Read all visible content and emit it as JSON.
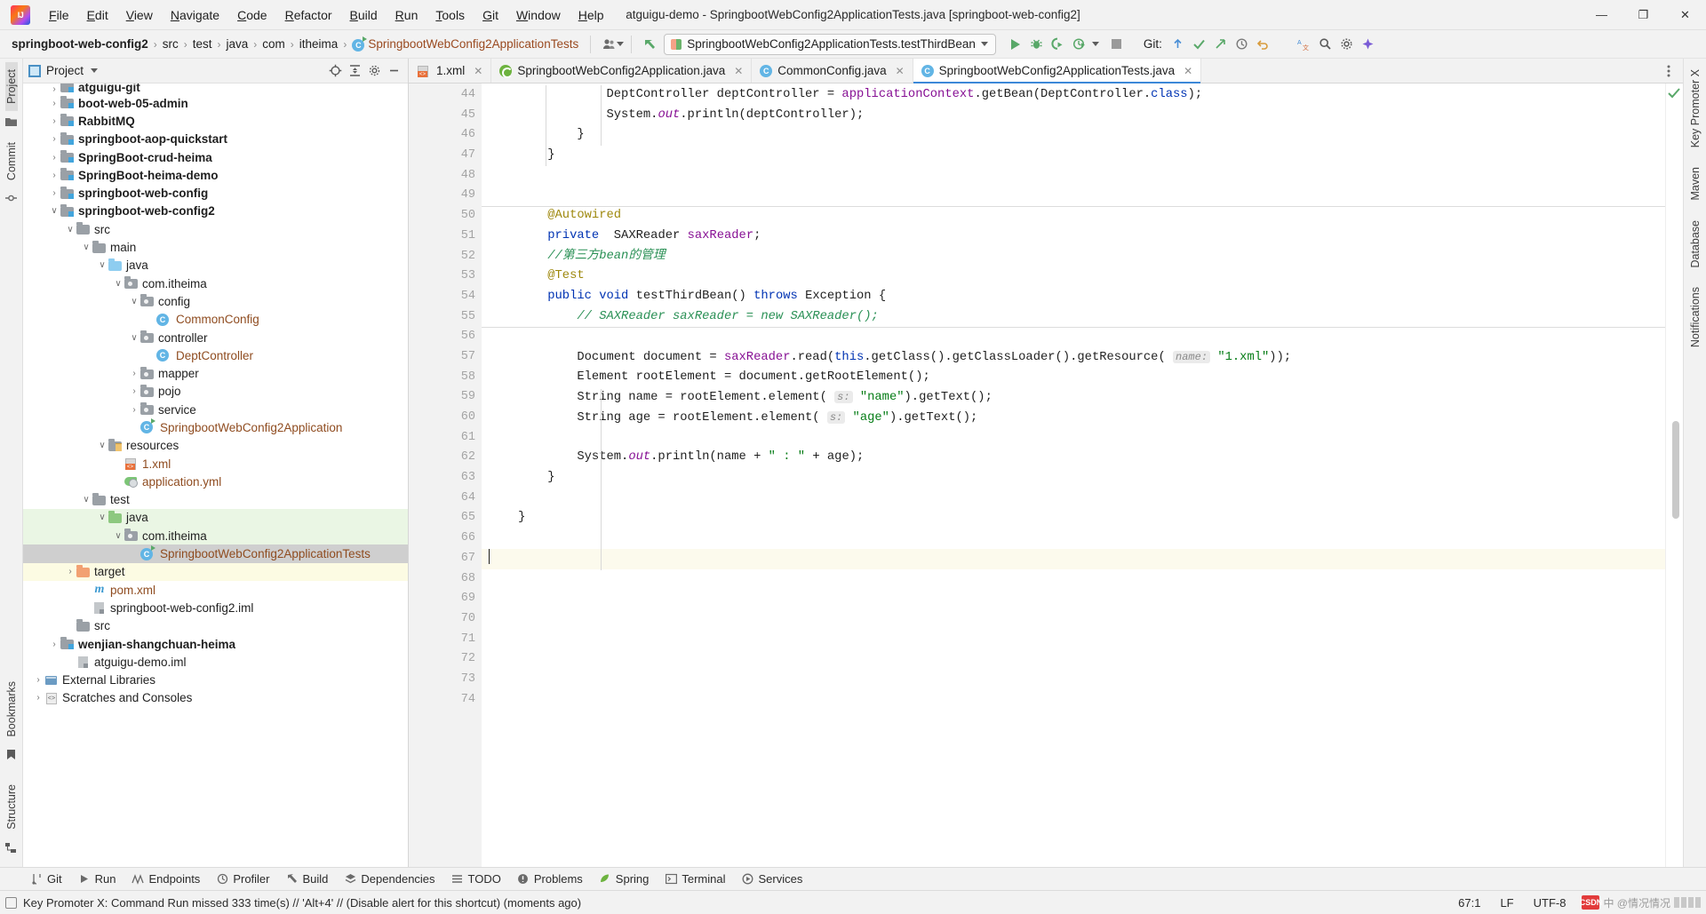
{
  "window": {
    "title": "atguigu-demo - SpringbootWebConfig2ApplicationTests.java [springboot-web-config2]",
    "minimize": "—",
    "maximize": "❐",
    "close": "✕"
  },
  "menu": [
    "File",
    "Edit",
    "View",
    "Navigate",
    "Code",
    "Refactor",
    "Build",
    "Run",
    "Tools",
    "Git",
    "Window",
    "Help"
  ],
  "breadcrumb": {
    "segments": [
      {
        "text": "springboot-web-config2",
        "bold": true,
        "type": "module"
      },
      {
        "text": "src",
        "bold": false,
        "type": "dir"
      },
      {
        "text": "test",
        "bold": false,
        "type": "dir"
      },
      {
        "text": "java",
        "bold": false,
        "type": "dir"
      },
      {
        "text": "com",
        "bold": false,
        "type": "dir"
      },
      {
        "text": "itheima",
        "bold": false,
        "type": "dir"
      },
      {
        "text": "SpringbootWebConfig2ApplicationTests",
        "bold": false,
        "type": "class"
      }
    ],
    "separator": "›"
  },
  "toolbar": {
    "avatar_icon": "user-icon",
    "back_icon": "back-arrow-icon",
    "run_config": "SpringbootWebConfig2ApplicationTests.testThirdBean",
    "run_icon": "run-icon",
    "debug_icon": "debug-icon",
    "coverage_icon": "run-with-coverage-icon",
    "profiler_icon": "profiler-icon",
    "stop_icon": "stop-icon",
    "git_label": "Git:",
    "git_update_icon": "update-project-icon",
    "git_commit_icon": "commit-icon",
    "git_push_icon": "push-icon",
    "history_icon": "history-icon",
    "undo_icon": "undo-icon",
    "translate_icon": "translate-icon",
    "search_icon": "search-icon",
    "settings_icon": "gear-icon",
    "ai_icon": "ai-assistant-icon"
  },
  "left_strip": {
    "top": [
      "Project",
      "Commit"
    ],
    "bottom": [
      "Bookmarks",
      "Structure"
    ]
  },
  "right_strip": [
    "Key Promoter X",
    "Maven",
    "Database",
    "Notifications"
  ],
  "project_panel": {
    "title": "Project",
    "locate_icon": "locate-icon",
    "collapse_icon": "collapse-all-icon",
    "settings_icon": "gear-icon",
    "hide_icon": "hide-icon",
    "tree": [
      {
        "indent": 1,
        "arrow": "›",
        "icon": "module",
        "label": "atguigu-git",
        "style": "bold",
        "clipped": true
      },
      {
        "indent": 1,
        "arrow": "›",
        "icon": "module",
        "label": "boot-web-05-admin",
        "style": "bold"
      },
      {
        "indent": 1,
        "arrow": "›",
        "icon": "module",
        "label": "RabbitMQ",
        "style": "bold"
      },
      {
        "indent": 1,
        "arrow": "›",
        "icon": "module",
        "label": "springboot-aop-quickstart",
        "style": "bold"
      },
      {
        "indent": 1,
        "arrow": "›",
        "icon": "module",
        "label": "SpringBoot-crud-heima",
        "style": "bold"
      },
      {
        "indent": 1,
        "arrow": "›",
        "icon": "module",
        "label": "SpringBoot-heima-demo",
        "style": "bold"
      },
      {
        "indent": 1,
        "arrow": "›",
        "icon": "module",
        "label": "springboot-web-config",
        "style": "bold"
      },
      {
        "indent": 1,
        "arrow": "∨",
        "icon": "module",
        "label": "springboot-web-config2",
        "style": "bold"
      },
      {
        "indent": 2,
        "arrow": "∨",
        "icon": "folder",
        "label": "src",
        "style": ""
      },
      {
        "indent": 3,
        "arrow": "∨",
        "icon": "folder",
        "label": "main",
        "style": ""
      },
      {
        "indent": 4,
        "arrow": "∨",
        "icon": "src",
        "label": "java",
        "style": ""
      },
      {
        "indent": 5,
        "arrow": "∨",
        "icon": "package",
        "label": "com.itheima",
        "style": ""
      },
      {
        "indent": 6,
        "arrow": "∨",
        "icon": "package",
        "label": "config",
        "style": ""
      },
      {
        "indent": 7,
        "arrow": "",
        "icon": "class",
        "label": "CommonConfig",
        "style": "brown"
      },
      {
        "indent": 6,
        "arrow": "∨",
        "icon": "package",
        "label": "controller",
        "style": ""
      },
      {
        "indent": 7,
        "arrow": "",
        "icon": "class",
        "label": "DeptController",
        "style": "brown"
      },
      {
        "indent": 6,
        "arrow": "›",
        "icon": "package",
        "label": "mapper",
        "style": ""
      },
      {
        "indent": 6,
        "arrow": "›",
        "icon": "package",
        "label": "pojo",
        "style": ""
      },
      {
        "indent": 6,
        "arrow": "›",
        "icon": "package",
        "label": "service",
        "style": ""
      },
      {
        "indent": 6,
        "arrow": "",
        "icon": "class-run",
        "label": "SpringbootWebConfig2Application",
        "style": "brown"
      },
      {
        "indent": 4,
        "arrow": "∨",
        "icon": "resources",
        "label": "resources",
        "style": ""
      },
      {
        "indent": 5,
        "arrow": "",
        "icon": "xml",
        "label": "1.xml",
        "style": "brown"
      },
      {
        "indent": 5,
        "arrow": "",
        "icon": "yml",
        "label": "application.yml",
        "style": "brown"
      },
      {
        "indent": 3,
        "arrow": "∨",
        "icon": "folder",
        "label": "test",
        "style": ""
      },
      {
        "indent": 4,
        "arrow": "∨",
        "icon": "test-src",
        "label": "java",
        "style": "",
        "row": "green"
      },
      {
        "indent": 5,
        "arrow": "∨",
        "icon": "package",
        "label": "com.itheima",
        "style": "",
        "row": "green"
      },
      {
        "indent": 6,
        "arrow": "",
        "icon": "class-run",
        "label": "SpringbootWebConfig2ApplicationTests",
        "style": "brown",
        "row": "selected"
      },
      {
        "indent": 2,
        "arrow": "›",
        "icon": "target",
        "label": "target",
        "style": "",
        "row": "yellow"
      },
      {
        "indent": 3,
        "arrow": "",
        "icon": "maven",
        "label": "pom.xml",
        "style": "brown"
      },
      {
        "indent": 3,
        "arrow": "",
        "icon": "iml",
        "label": "springboot-web-config2.iml",
        "style": ""
      },
      {
        "indent": 2,
        "arrow": "",
        "icon": "folder",
        "label": "src",
        "style": ""
      },
      {
        "indent": 1,
        "arrow": "›",
        "icon": "module",
        "label": "wenjian-shangchuan-heima",
        "style": "bold"
      },
      {
        "indent": 2,
        "arrow": "",
        "icon": "iml",
        "label": "atguigu-demo.iml",
        "style": ""
      },
      {
        "indent": 0,
        "arrow": "›",
        "icon": "library",
        "label": "External Libraries",
        "style": ""
      },
      {
        "indent": 0,
        "arrow": "›",
        "icon": "scratch",
        "label": "Scratches and Consoles",
        "style": ""
      }
    ]
  },
  "editor_tabs": [
    {
      "label": "1.xml",
      "icon": "xml-file-icon",
      "active": false,
      "close": "✕"
    },
    {
      "label": "SpringbootWebConfig2Application.java",
      "icon": "spring-class-icon",
      "active": false,
      "close": "✕"
    },
    {
      "label": "CommonConfig.java",
      "icon": "java-class-icon",
      "active": false,
      "close": "✕"
    },
    {
      "label": "SpringbootWebConfig2ApplicationTests.java",
      "icon": "java-class-icon",
      "active": true,
      "close": "✕"
    }
  ],
  "editor": {
    "first_line": 44,
    "lines": [
      {
        "n": 44,
        "html": "                DeptController deptController = <span class='fld'>applicationContext</span>.getBean(DeptController.<span class='kw'>class</span>);"
      },
      {
        "n": 45,
        "html": "                System.<span class='sfld'>out</span>.println(deptController);"
      },
      {
        "n": 46,
        "html": "            }",
        "fold": true
      },
      {
        "n": 47,
        "html": "        }",
        "fold": true
      },
      {
        "n": 48,
        "html": ""
      },
      {
        "n": 49,
        "html": ""
      },
      {
        "n": 50,
        "html": "        <span class='ann'>@Autowired</span>",
        "sep_above": true
      },
      {
        "n": 51,
        "html": "        <span class='kw'>private</span>  SAXReader <span class='fld'>saxReader</span>;",
        "mark": "bean"
      },
      {
        "n": 52,
        "html": "        <span class='cmg'>//第三方bean的管理</span>",
        "sep_above": true
      },
      {
        "n": 53,
        "html": "        <span class='ann'>@Test</span>"
      },
      {
        "n": 54,
        "html": "        <span class='kw'>public</span> <span class='kw'>void</span> testThirdBean() <span class='kw'>throws</span> Exception {",
        "mark": "test",
        "fold": true
      },
      {
        "n": 55,
        "html": "            <span class='cmg'>// SAXReader saxReader = new SAXReader();</span>"
      },
      {
        "n": 56,
        "html": ""
      },
      {
        "n": 57,
        "html": "            Document document = <span class='fld'>saxReader</span>.read(<span class='kw'>this</span>.getClass().getClassLoader().getResource( <span class='hint'>name:</span> <span class='st'>\"1.xml\"</span>));"
      },
      {
        "n": 58,
        "html": "            Element rootElement = document.getRootElement();"
      },
      {
        "n": 59,
        "html": "            String name = rootElement.element( <span class='hint'>s:</span> <span class='st'>\"name\"</span>).getText();"
      },
      {
        "n": 60,
        "html": "            String age = rootElement.element( <span class='hint'>s:</span> <span class='st'>\"age\"</span>).getText();"
      },
      {
        "n": 61,
        "html": ""
      },
      {
        "n": 62,
        "html": "            System.<span class='sfld'>out</span>.println(name + <span class='st'>\" : \"</span> + age);"
      },
      {
        "n": 63,
        "html": "        }",
        "fold": true
      },
      {
        "n": 64,
        "html": ""
      },
      {
        "n": 65,
        "html": "    }"
      },
      {
        "n": 66,
        "html": ""
      },
      {
        "n": 67,
        "html": "<span class='caretbar'></span>",
        "current": true
      },
      {
        "n": 68,
        "html": ""
      },
      {
        "n": 69,
        "html": ""
      },
      {
        "n": 70,
        "html": ""
      },
      {
        "n": 71,
        "html": ""
      },
      {
        "n": 72,
        "html": ""
      },
      {
        "n": 73,
        "html": ""
      },
      {
        "n": 74,
        "html": ""
      }
    ]
  },
  "tool_windows": [
    {
      "label": "Git",
      "icon": "git-branch-icon"
    },
    {
      "label": "Run",
      "icon": "run-icon"
    },
    {
      "label": "Endpoints",
      "icon": "endpoints-icon"
    },
    {
      "label": "Profiler",
      "icon": "profiler-icon"
    },
    {
      "label": "Build",
      "icon": "build-hammer-icon"
    },
    {
      "label": "Dependencies",
      "icon": "dependencies-icon"
    },
    {
      "label": "TODO",
      "icon": "todo-icon"
    },
    {
      "label": "Problems",
      "icon": "problems-icon"
    },
    {
      "label": "Spring",
      "icon": "spring-leaf-icon"
    },
    {
      "label": "Terminal",
      "icon": "terminal-icon"
    },
    {
      "label": "Services",
      "icon": "services-icon"
    }
  ],
  "statusbar": {
    "message_icon": "notification-icon",
    "message": "Key Promoter X: Command Run missed 333 time(s) // 'Alt+4' // (Disable alert for this shortcut) (moments ago)",
    "caret_position": "67:1",
    "line_separator": "LF",
    "encoding": "UTF-8",
    "watermark_logo": "CSDN",
    "watermark_text": "中 @情况情况"
  },
  "colors": {
    "accent": "#3c88d8",
    "run_green": "#59a869",
    "brown_text": "#8f4c20",
    "keyword_blue": "#0033b3",
    "string_green": "#067d17",
    "annotation_gold": "#9e880d",
    "field_purple": "#871094",
    "selection_grey": "#cfcfcf",
    "testsrc_green": "#eaf6e4",
    "target_yellow": "#fcfbe3"
  }
}
